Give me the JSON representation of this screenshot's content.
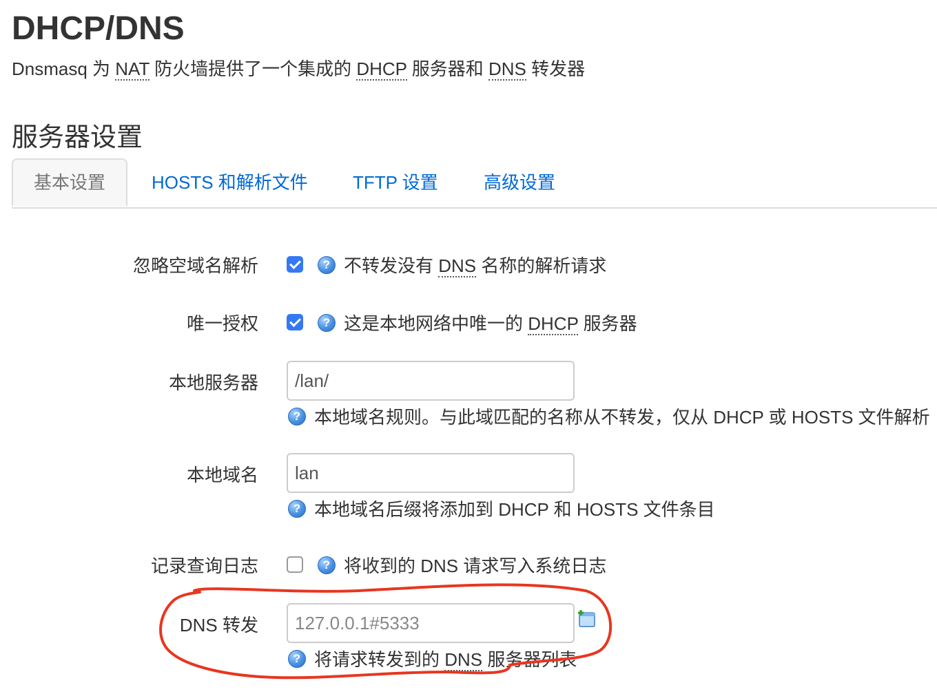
{
  "page": {
    "title": "DHCP/DNS",
    "description": {
      "part1": "Dnsmasq 为 ",
      "nat": "NAT",
      "part2": " 防火墙提供了一个集成的 ",
      "dhcp": "DHCP",
      "part3": " 服务器和 ",
      "dns": "DNS",
      "part4": " 转发器"
    }
  },
  "section": {
    "title": "服务器设置"
  },
  "tabs": [
    {
      "label": "基本设置",
      "active": true
    },
    {
      "label": "HOSTS 和解析文件",
      "active": false
    },
    {
      "label": "TFTP 设置",
      "active": false
    },
    {
      "label": "高级设置",
      "active": false
    }
  ],
  "fields": {
    "domain_needed": {
      "label": "忽略空域名解析",
      "checked": true,
      "help_prefix": "不转发没有 ",
      "help_abbr": "DNS",
      "help_suffix": " 名称的解析请求"
    },
    "authoritative": {
      "label": "唯一授权",
      "checked": true,
      "help_prefix": "这是本地网络中唯一的 ",
      "help_abbr": "DHCP",
      "help_suffix": " 服务器"
    },
    "local_server": {
      "label": "本地服务器",
      "value": "/lan/",
      "help": "本地域名规则。与此域匹配的名称从不转发，仅从 DHCP 或 HOSTS 文件解析"
    },
    "local_domain": {
      "label": "本地域名",
      "value": "lan",
      "help": "本地域名后缀将添加到 DHCP 和 HOSTS 文件条目"
    },
    "log_queries": {
      "label": "记录查询日志",
      "checked": false,
      "help": "将收到的 DNS 请求写入系统日志"
    },
    "dns_forward": {
      "label": "DNS 转发",
      "placeholder": "127.0.0.1#5333",
      "help_prefix": "将请求转发到的 ",
      "help_abbr": "DNS",
      "help_suffix": " 服务器列表"
    }
  },
  "icons": {
    "help": "help-icon",
    "add": "add-entry-icon"
  },
  "colors": {
    "link": "#0069d6",
    "checkbox_checked": "#3478f6",
    "annotation": "#e8361f"
  }
}
